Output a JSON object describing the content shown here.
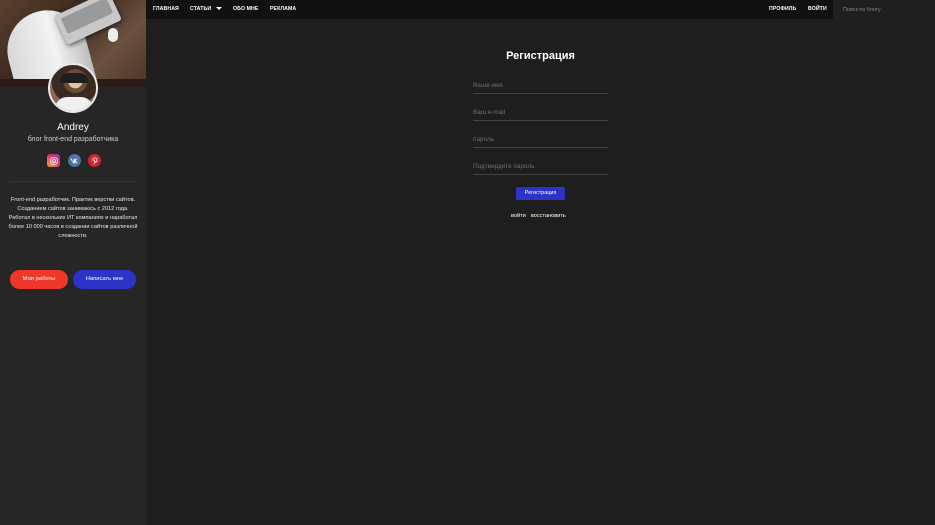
{
  "nav": {
    "items": [
      "ГЛАВНАЯ",
      "СТАТЬИ",
      "ОБО МНЕ",
      "РЕКЛАМА"
    ],
    "profile": "ПРОФИЛЬ",
    "login": "ВОЙТИ",
    "search_placeholder": "Поиск по блогу"
  },
  "sidebar": {
    "name": "Andrey",
    "tagline": "блог front-end разработчика",
    "socials": [
      "instagram-icon",
      "vk-icon",
      "pinterest-icon"
    ],
    "about": "Front-end разработчик. Практик верстки сайтов. Созданием сайтов занимаюсь с 2012 года. Работал в нескольких ИТ компаниях и наработал более 10 000 часов в создании сайтов различной сложности.",
    "works_button": "Мои работы",
    "write_button": "Написать мне"
  },
  "form": {
    "title": "Регистрация",
    "name_placeholder": "Ваше имя",
    "email_placeholder": "Ваш e-mail",
    "password_placeholder": "пароль",
    "confirm_placeholder": "Подтвердите пароль",
    "submit": "Регистрация",
    "login_link": "войти",
    "restore_link": "восстановить"
  },
  "colors": {
    "accent_blue": "#2b34c6",
    "accent_red": "#f1362a",
    "background": "#1e1e1e",
    "sidebar": "#262626",
    "topbar": "#111111"
  }
}
